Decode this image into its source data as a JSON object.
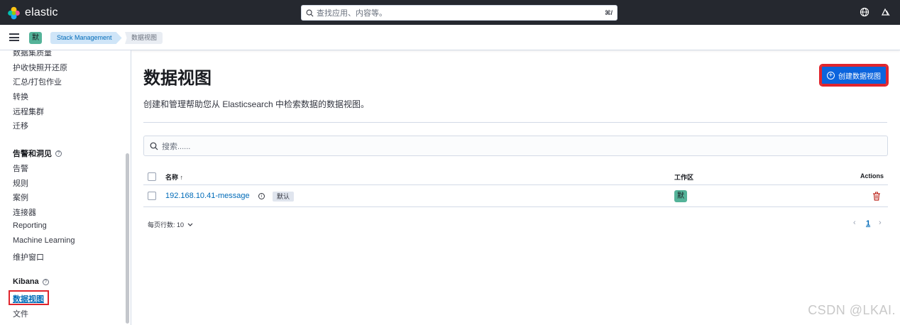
{
  "app": {
    "brand": "elastic"
  },
  "global_search": {
    "placeholder": "查找应用、内容等。",
    "shortcut": "⌘/"
  },
  "breadcrumbs": {
    "space_initial": "默",
    "items": [
      "Stack Management",
      "数据视图"
    ]
  },
  "sidebar": {
    "items_top": [
      "数据集质量",
      "护收快照开还原",
      "汇总/打包作业",
      "转换",
      "远程集群",
      "迁移"
    ],
    "groups": [
      {
        "title": "告警和洞见",
        "items": [
          "告警",
          "规则",
          "案例",
          "连接器",
          "Reporting",
          "Machine Learning",
          "维护窗口"
        ]
      },
      {
        "title": "Kibana",
        "items": [
          "数据视图",
          "文件"
        ]
      }
    ],
    "help_glyph": "?"
  },
  "page": {
    "title": "数据视图",
    "description": "创建和管理帮助您从 Elasticsearch 中检索数据的数据视图。",
    "create_button": "创建数据视图",
    "search_placeholder": "搜索......"
  },
  "table": {
    "columns": {
      "name": "名称",
      "sort_indicator": "↑",
      "workspace": "工作区",
      "actions": "Actions"
    },
    "rows": [
      {
        "name": "192.168.10.41-message",
        "badge": "默认",
        "info_glyph": "i",
        "workspace_initial": "默"
      }
    ]
  },
  "pagination": {
    "rows_per_page_label": "每页行数: 10",
    "current_page": "1",
    "prev_glyph": "‹",
    "next_glyph": "›"
  },
  "watermark": "CSDN @LKAI.",
  "colors": {
    "topbar": "#25282f",
    "accent": "#0b64dd",
    "link": "#006bb8",
    "space_badge": "#54b399",
    "highlight": "#e0252d"
  }
}
